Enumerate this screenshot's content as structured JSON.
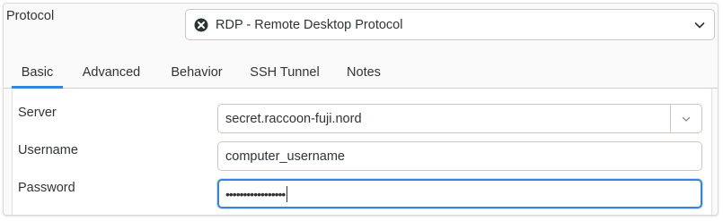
{
  "protocol": {
    "label": "Protocol",
    "selected": "RDP - Remote Desktop Protocol",
    "icon": "protocol-x-icon",
    "dropdown_icon": "chevron-down-icon"
  },
  "tabs": [
    {
      "label": "Basic",
      "active": true
    },
    {
      "label": "Advanced",
      "active": false
    },
    {
      "label": "Behavior",
      "active": false
    },
    {
      "label": "SSH Tunnel",
      "active": false
    },
    {
      "label": "Notes",
      "active": false
    }
  ],
  "fields": {
    "server": {
      "label": "Server",
      "value": "secret.raccoon-fuji.nord"
    },
    "username": {
      "label": "Username",
      "value": "computer_username"
    },
    "password": {
      "label": "Password",
      "value": "•••••••••••••••••"
    }
  },
  "colors": {
    "accent": "#3584e4",
    "text": "#2e3436",
    "border": "#cdc7c2"
  }
}
